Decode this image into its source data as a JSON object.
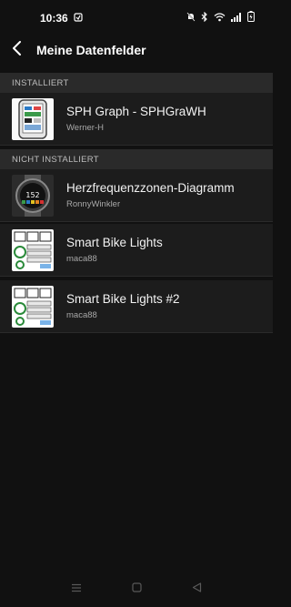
{
  "status": {
    "time": "10:36"
  },
  "header": {
    "title": "Meine Datenfelder"
  },
  "sections": {
    "installed": "INSTALLIERT",
    "not_installed": "NICHT INSTALLIERT"
  },
  "items": [
    {
      "name": "SPH Graph - SPHGraWH",
      "author": "Werner-H"
    },
    {
      "name": "Herzfrequenzzonen-Diagramm",
      "author": "RonnyWinkler",
      "watch_value": "152"
    },
    {
      "name": "Smart Bike Lights",
      "author": "maca88"
    },
    {
      "name": "Smart Bike Lights #2",
      "author": "maca88"
    }
  ]
}
